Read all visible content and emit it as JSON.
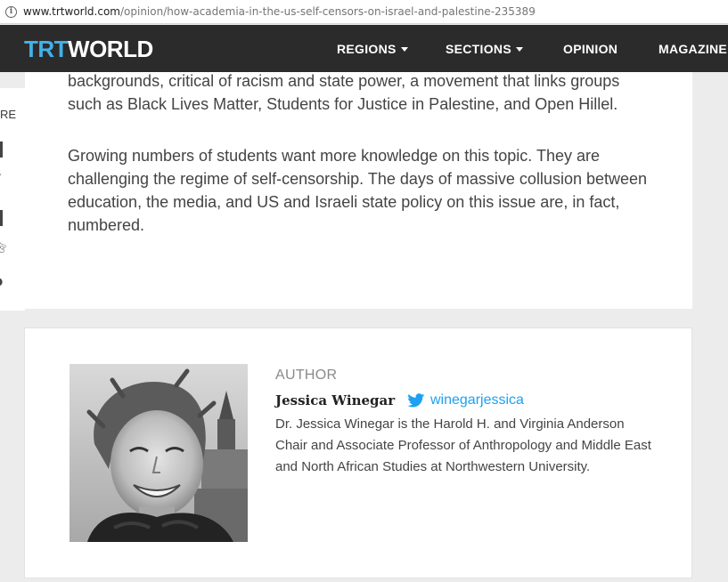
{
  "browser": {
    "url_host": "www.trtworld.com",
    "url_path": "/opinion/how-academia-in-the-us-self-censors-on-israel-and-palestine-235389"
  },
  "header": {
    "logo_trt": "TRT",
    "logo_world": "WORLD",
    "nav": {
      "regions": "REGIONS",
      "sections": "SECTIONS",
      "opinion": "OPINION",
      "magazine": "MAGAZINE"
    }
  },
  "sidebar": {
    "label": "RE"
  },
  "article": {
    "paragraph_1": "backgrounds, critical of racism and state power, a movement that links groups such as Black Lives Matter, Students for Justice in Palestine, and Open Hillel.",
    "paragraph_2": "Growing numbers of students want more knowledge on this topic. They are challenging the regime of self-censorship. The days of massive collusion between education, the media, and US and Israeli state policy on this issue are, in fact, numbered."
  },
  "author": {
    "label": "AUTHOR",
    "name": "Jessica Winegar",
    "twitter_icon": "twitter-bird-icon",
    "twitter_handle": "winegarjessica",
    "bio": "Dr. Jessica Winegar is the Harold H. and Virginia Anderson Chair and Associate Professor of Anthropology and Middle East and North African Studies at Northwestern University."
  },
  "colors": {
    "header_bg": "#2b2b2b",
    "brand_blue": "#42b2e8",
    "twitter_blue": "#1da1f2",
    "page_bg": "#ececec"
  }
}
